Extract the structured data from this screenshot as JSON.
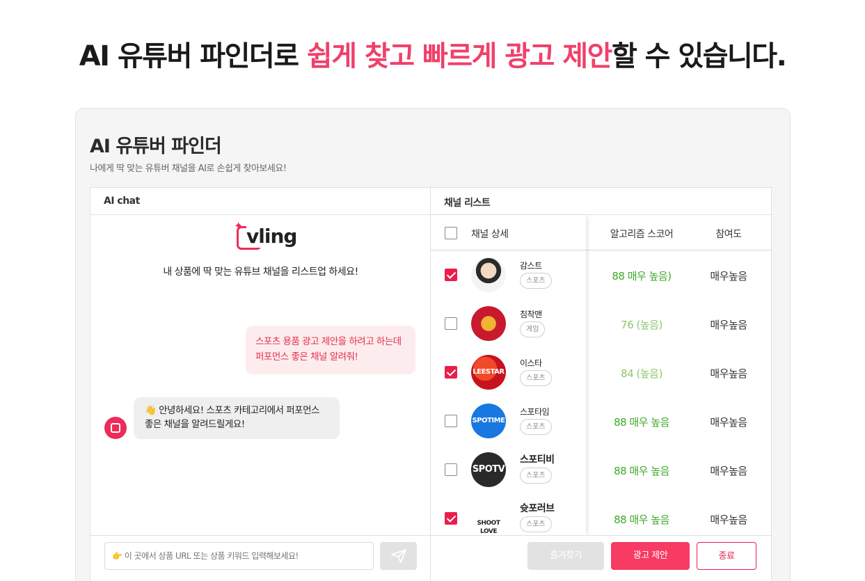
{
  "hero": {
    "prefix": "AI 유튜버 파인더로 ",
    "highlight": "쉽게 찾고 빠르게 광고 제안",
    "suffix": "할 수 있습니다."
  },
  "panel": {
    "title": "AI 유튜버 파인더",
    "subtitle": "나에게 딱 맞는 유튜버 채널을 AI로 손쉽게 찾아보세요!"
  },
  "chat": {
    "header": "AI chat",
    "logo_text": "vling",
    "intro": "내 상품에 딱 맞는 유튜브 채널을 리스트업 하세요!",
    "user_message_line1": "스포츠 용품 광고 제안을 하려고 하는데",
    "user_message_line2": "퍼포먼스 좋은 채널 알려줘!",
    "bot_message_line1": "👋 안녕하세요! 스포츠 카테고리에서 퍼포먼스",
    "bot_message_line2": "좋은 채널을 알려드릴게요!",
    "input_placeholder": "👉 이 곳에서 상품 URL 또는 상품 키워드 입력해보세요!"
  },
  "list": {
    "header": "채널 리스트",
    "columns": {
      "detail": "채널 상세",
      "score": "알고리즘 스코어",
      "participation": "참여도"
    },
    "rows": [
      {
        "name": "감스트",
        "tag": "스포츠",
        "score": "88 매우 높음)",
        "participation": "매우높음",
        "checked": true,
        "avatar_text": ""
      },
      {
        "name": "침착맨",
        "tag": "게임",
        "score": "76 (높음)",
        "participation": "매우높음",
        "checked": false,
        "avatar_text": ""
      },
      {
        "name": "이스타",
        "tag": "스포츠",
        "score": "84 (높음)",
        "participation": "매우높음",
        "checked": true,
        "avatar_text": "LEESTAR"
      },
      {
        "name": "스포타임",
        "tag": "스포츠",
        "score": "88 매우 높음",
        "participation": "매우높음",
        "checked": false,
        "avatar_text": "SPOTIME"
      },
      {
        "name": "스포티비",
        "tag": "스포츠",
        "score": "88 매우 높음",
        "participation": "매우높음",
        "checked": false,
        "avatar_text": "SPOTV"
      },
      {
        "name": "슛포러브",
        "tag": "스포츠",
        "score": "88 매우 높음",
        "participation": "매우높음",
        "checked": true,
        "avatar_text": "SHOOT LOVE"
      }
    ],
    "buttons": {
      "favorite": "즐겨찾기",
      "propose": "광고 제안",
      "close": "종료"
    }
  },
  "colors": {
    "accent": "#f0406a",
    "score_green": "#3ea82a",
    "score_light": "#8cc66b"
  }
}
